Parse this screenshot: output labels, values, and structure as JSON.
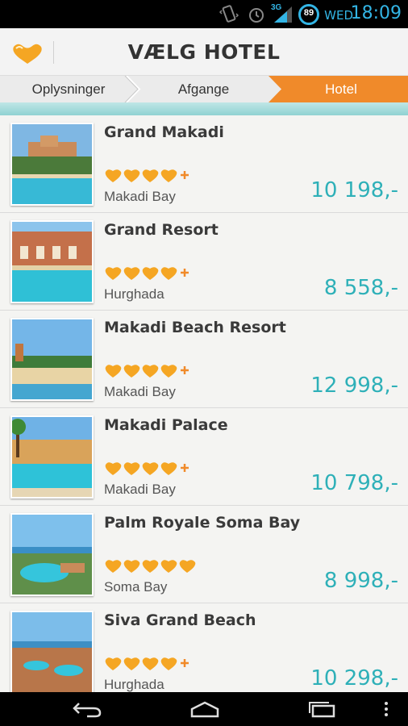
{
  "status_bar": {
    "signal_label": "3G",
    "battery_level": "89",
    "day": "WED",
    "time": "18:09",
    "icons": [
      "vibrate-icon",
      "alarm-icon",
      "signal-icon",
      "battery-icon"
    ]
  },
  "header": {
    "title": "VÆLG HOTEL",
    "logo": "thomson-heart-logo"
  },
  "steps": [
    {
      "label": "Oplysninger",
      "active": false
    },
    {
      "label": "Afgange",
      "active": false
    },
    {
      "label": "Hotel",
      "active": true
    }
  ],
  "colors": {
    "accent": "#f08a2a",
    "price": "#2eb0b8",
    "heart": "#f5a623"
  },
  "hotels": [
    {
      "name": "Grand Makadi",
      "location": "Makadi Bay",
      "price": "10 198,-",
      "hearts": 4,
      "plus": true
    },
    {
      "name": "Grand Resort",
      "location": "Hurghada",
      "price": "8 558,-",
      "hearts": 4,
      "plus": true
    },
    {
      "name": "Makadi Beach Resort",
      "location": "Makadi Bay",
      "price": "12 998,-",
      "hearts": 4,
      "plus": true
    },
    {
      "name": "Makadi Palace",
      "location": "Makadi Bay",
      "price": "10 798,-",
      "hearts": 4,
      "plus": true
    },
    {
      "name": "Palm Royale Soma Bay",
      "location": "Soma Bay",
      "price": "8 998,-",
      "hearts": 5,
      "plus": false
    },
    {
      "name": "Siva Grand Beach",
      "location": "Hurghada",
      "price": "10 298,-",
      "hearts": 4,
      "plus": true
    }
  ],
  "nav": [
    "back-icon",
    "home-icon",
    "recent-apps-icon",
    "overflow-menu-icon"
  ]
}
